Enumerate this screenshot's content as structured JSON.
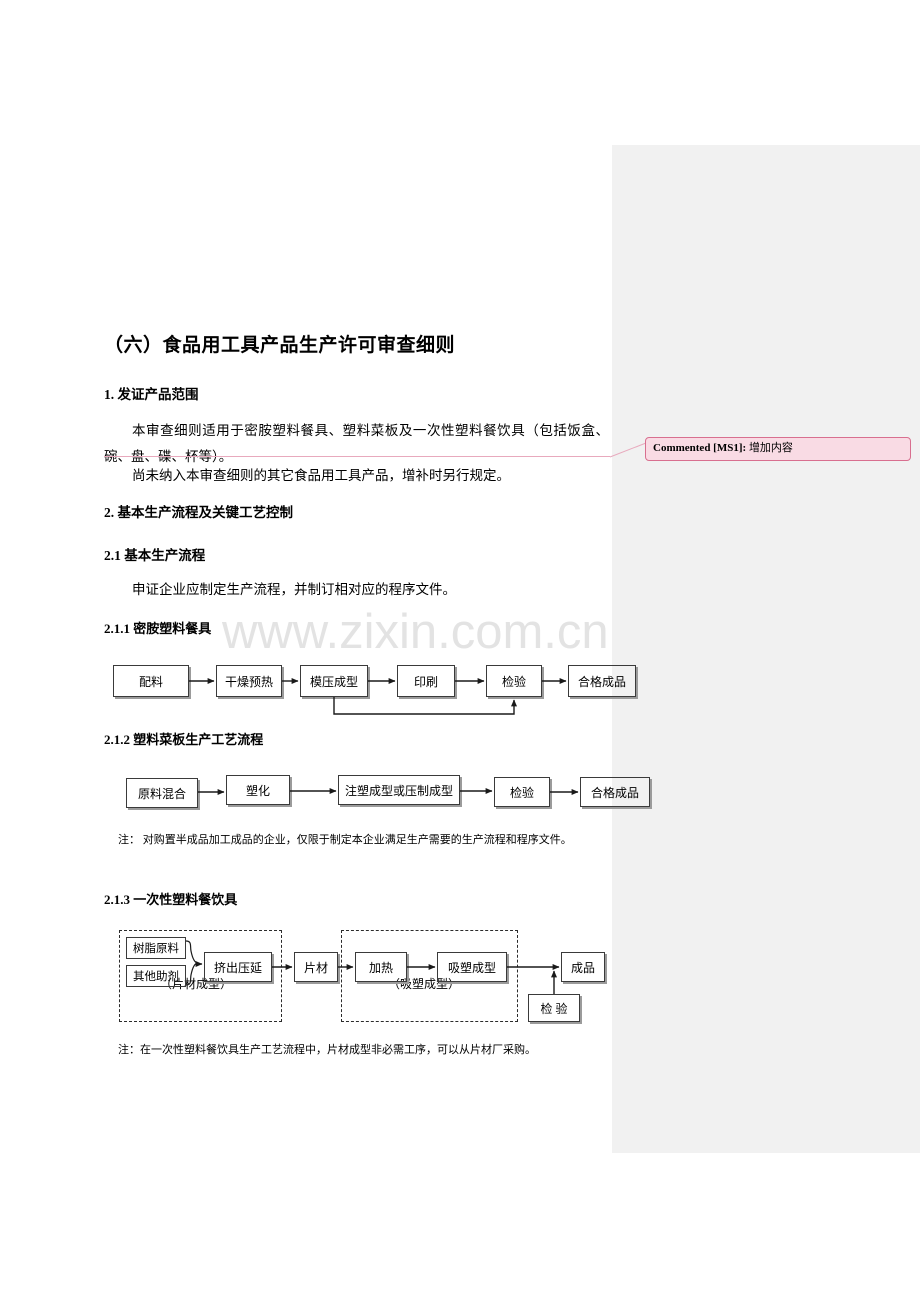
{
  "document": {
    "title": "（六）食品用工具产品生产许可审查细则",
    "watermark": "www.zixin.com.cn",
    "sections": {
      "s1_heading": "1. 发证产品范围",
      "s1_para1": "本审查细则适用于密胺塑料餐具、塑料菜板及一次性塑料餐饮具（包括饭盒、碗、盘、碟、杯等）。",
      "s1_para2": "尚未纳入本审查细则的其它食品用工具产品，增补时另行规定。",
      "s2_heading": "2. 基本生产流程及关键工艺控制",
      "s21_heading": "2.1  基本生产流程",
      "s21_para": "申证企业应制定生产流程，并制订相对应的程序文件。",
      "s211_heading": "2.1.1  密胺塑料餐具",
      "s212_heading": "2.1.2  塑料菜板生产工艺流程",
      "s212_note": "注：  对购置半成品加工成品的企业，仅限于制定本企业满足生产需要的生产流程和程序文件。",
      "s213_heading": "2.1.3  一次性塑料餐饮具",
      "s213_note": "注：在一次性塑料餐饮具生产工艺流程中，片材成型非必需工序，可以从片材厂采购。"
    }
  },
  "comment": {
    "label": "Commented [MS1]:",
    "text": "增加内容",
    "background": "#f9dbe4",
    "border": "#d86f8f"
  },
  "flowchart_1": {
    "id": "密胺塑料餐具生产流程",
    "nodes": [
      {
        "label": "配料"
      },
      {
        "label": "干燥预热"
      },
      {
        "label": "模压成型"
      },
      {
        "label": "印刷"
      },
      {
        "label": "检验"
      },
      {
        "label": "合格成品"
      }
    ]
  },
  "flowchart_2": {
    "id": "塑料菜板生产工艺流程",
    "nodes": [
      {
        "label": "原料混合"
      },
      {
        "label": "塑化"
      },
      {
        "label": "注塑成型或压制成型"
      },
      {
        "label": "检验"
      },
      {
        "label": "合格成品"
      }
    ]
  },
  "flowchart_3": {
    "id": "一次性塑料餐饮具生产工艺流程",
    "nodes": [
      {
        "label": "树脂原料"
      },
      {
        "label": "其他助剂"
      },
      {
        "label": "挤出压延"
      },
      {
        "label": "片材"
      },
      {
        "label": "加热"
      },
      {
        "label": "吸塑成型"
      },
      {
        "label": "成品"
      },
      {
        "label": "检 验"
      }
    ],
    "group_labels": [
      {
        "label": "（片材成型）"
      },
      {
        "label": "（吸塑成型）"
      }
    ]
  }
}
